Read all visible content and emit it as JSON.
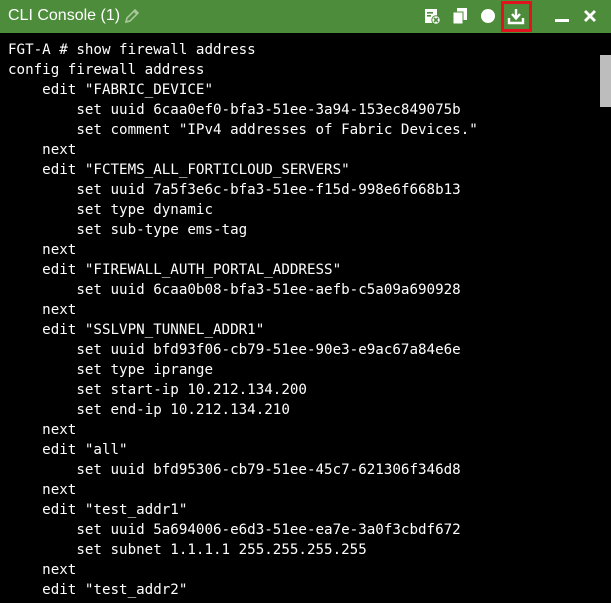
{
  "window": {
    "title": "CLI Console (1)"
  },
  "colors": {
    "titlebar_bg": "#4c8c3a",
    "console_bg": "#000000",
    "console_text": "#ffffff",
    "highlight": "#e0141e",
    "scrollbar_thumb": "#bdbdbd"
  },
  "toolbar": {
    "icons": [
      "edit-pencil-icon",
      "clear-console-icon",
      "copy-icon",
      "circle-icon",
      "download-icon",
      "minimize-icon",
      "close-icon"
    ],
    "highlighted": "download-icon"
  },
  "console": {
    "lines": [
      "FGT-A # show firewall address",
      "config firewall address",
      "    edit \"FABRIC_DEVICE\"",
      "        set uuid 6caa0ef0-bfa3-51ee-3a94-153ec849075b",
      "        set comment \"IPv4 addresses of Fabric Devices.\"",
      "    next",
      "    edit \"FCTEMS_ALL_FORTICLOUD_SERVERS\"",
      "        set uuid 7a5f3e6c-bfa3-51ee-f15d-998e6f668b13",
      "        set type dynamic",
      "        set sub-type ems-tag",
      "    next",
      "    edit \"FIREWALL_AUTH_PORTAL_ADDRESS\"",
      "        set uuid 6caa0b08-bfa3-51ee-aefb-c5a09a690928",
      "    next",
      "    edit \"SSLVPN_TUNNEL_ADDR1\"",
      "        set uuid bfd93f06-cb79-51ee-90e3-e9ac67a84e6e",
      "        set type iprange",
      "        set start-ip 10.212.134.200",
      "        set end-ip 10.212.134.210",
      "    next",
      "    edit \"all\"",
      "        set uuid bfd95306-cb79-51ee-45c7-621306f346d8",
      "    next",
      "    edit \"test_addr1\"",
      "        set uuid 5a694006-e6d3-51ee-ea7e-3a0f3cbdf672",
      "        set subnet 1.1.1.1 255.255.255.255",
      "    next",
      "    edit \"test_addr2\""
    ]
  }
}
